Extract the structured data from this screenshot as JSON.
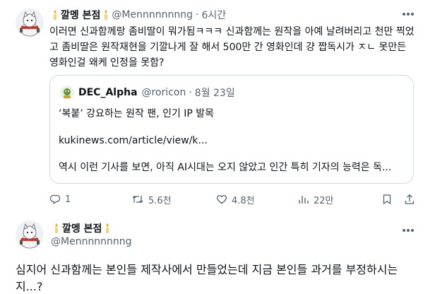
{
  "tweet": {
    "display_name": "깔멩 본점",
    "handle": "@Mennnnnnnng",
    "separator": "·",
    "time": "6시간",
    "text": "이러면 신과함께랑 좀비딸이 뭐가됨ㅋㅋㅋ 신과함께는 원작을 아예 날려버리고 천만 찍었고 좀비딸은 원작재현을 기깔나게 잘 해서 500만 간 영화인데 걍 짭독시가 ㅈㄴ 못만든 영화인걸 왜케 인정을 못함?",
    "quote": {
      "display_name": "DEC_Alpha",
      "handle": "@roricon",
      "separator": "·",
      "date": "8월 23일",
      "headline": "‘복붙’ 강요하는 원작 팬, 인기 IP 발목",
      "link": "kukinews.com/article/view/k...",
      "text": "역시 이런 기사를 보면, 아직 AI시대는 오지 않았고 인간 특히 기자의 능력은 독..."
    },
    "actions": {
      "replies": "1",
      "retweets": "5.6천",
      "likes": "4.8천",
      "views": "22만"
    }
  },
  "reply": {
    "display_name": "깔멩 본점",
    "handle": "@Mennnnnnnng",
    "text": "심지어 신과함께는 본인들 제작사에서 만들었는데 지금 본인들 과거를 부정하시는 지...?"
  },
  "colors": {
    "text": "#0f1419",
    "muted": "#536471",
    "border": "#cfd9de"
  }
}
